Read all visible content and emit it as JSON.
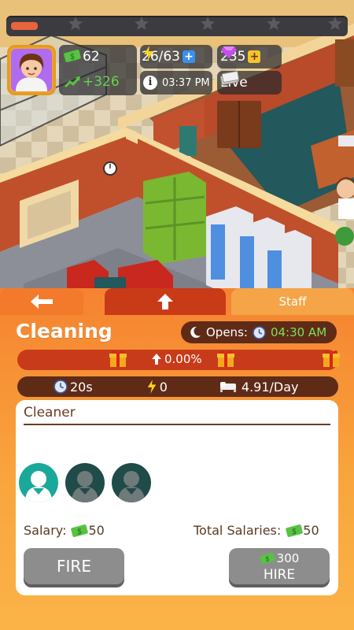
{
  "hud": {
    "level_progress": 0.08,
    "cash": "62",
    "income": "+326",
    "energy": "26/63",
    "gems": "235",
    "time": "03:37 PM",
    "live_label": "Live"
  },
  "panel": {
    "tabs": {
      "staff": "Staff"
    },
    "title": "Cleaning",
    "opens_label": "Opens:",
    "opens_time": "04:30 AM",
    "progress_percent": "0.00%",
    "stats": {
      "duration": "20s",
      "energy": "0",
      "rate": "4.91/Day"
    },
    "staff_card": {
      "role": "Cleaner",
      "salary_label": "Salary:",
      "salary_value": "50",
      "total_label": "Total Salaries:",
      "total_value": "50",
      "fire_label": "FIRE",
      "hire_cost": "300",
      "hire_label": "HIRE"
    }
  },
  "colors": {
    "accent": "#f47a2b",
    "dark": "#5e2b17",
    "green_text": "#7fe05a",
    "button": "#8d8d8d"
  },
  "icons": [
    "star-icon",
    "cash-icon",
    "income-icon",
    "energy-icon",
    "plus-icon",
    "gem-icon",
    "info-icon",
    "live-icon",
    "back-arrow-icon",
    "upgrade-arrow-icon",
    "moon-icon",
    "clock-icon",
    "gift-icon",
    "bed-icon"
  ]
}
